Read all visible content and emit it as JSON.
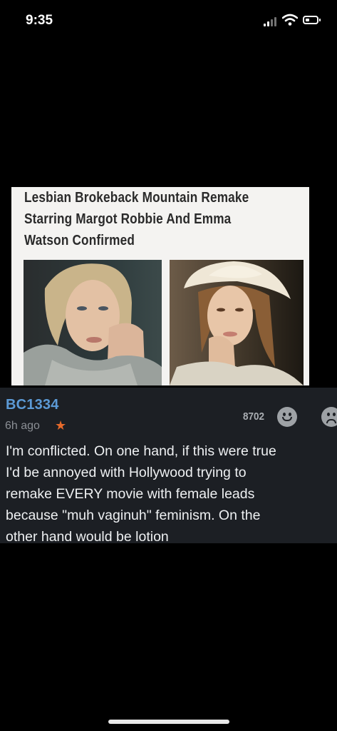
{
  "status_bar": {
    "time": "9:35"
  },
  "article": {
    "headline": "Lesbian Brokeback Mountain Remake\nStarring Margot Robbie And Emma\nWatson Confirmed"
  },
  "comment": {
    "username": "BC1334",
    "time_ago": "6h ago",
    "points": "8702",
    "text": "I'm conflicted. On one hand, if this were true\nI'd be annoyed with Hollywood trying to\nremake EVERY movie with female leads\nbecause \"muh vaginuh\" feminism. On the\nother hand would be lotion"
  },
  "icons": {
    "star": "star-icon",
    "upvote": "smiley-face-icon",
    "downvote": "frowny-face-icon"
  },
  "colors": {
    "background": "#000000",
    "comment_bg": "#1c1f24",
    "username": "#5c9ad6",
    "star": "#e66a2b",
    "article_bg": "#f4f3f1"
  }
}
